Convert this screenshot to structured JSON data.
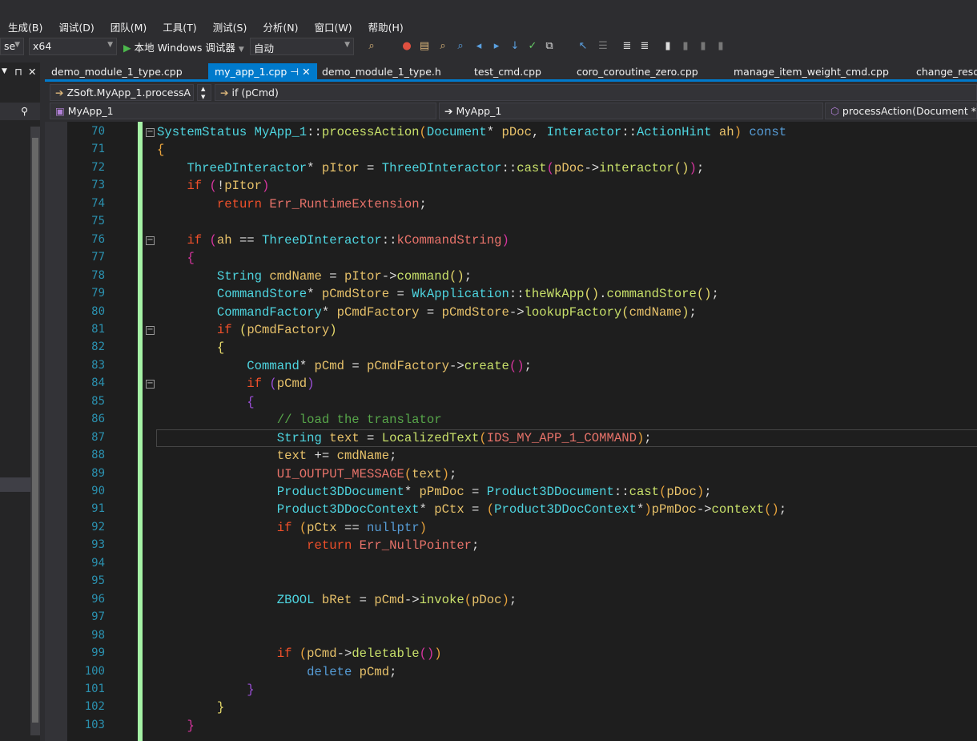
{
  "menu": [
    "生成(B)",
    "调试(D)",
    "团队(M)",
    "工具(T)",
    "测试(S)",
    "分析(N)",
    "窗口(W)",
    "帮助(H)"
  ],
  "toolbar": {
    "config": "se",
    "platform": "x64",
    "run_label": "本地 Windows 调试器",
    "run_icon": "play-icon",
    "mode": "自动"
  },
  "left_panel": {
    "pin": "⊓",
    "close": "✕"
  },
  "tabs": [
    {
      "label": "demo_module_1_type.cpp",
      "active": false
    },
    {
      "label": "my_app_1.cpp",
      "active": true
    },
    {
      "label": "demo_module_1_type.h",
      "active": false
    },
    {
      "label": "test_cmd.cpp",
      "active": false
    },
    {
      "label": "coro_coroutine_zero.cpp",
      "active": false
    },
    {
      "label": "manage_item_weight_cmd.cpp",
      "active": false
    },
    {
      "label": "change_resol",
      "active": false
    }
  ],
  "nav": {
    "scope": "ZSoft.MyApp_1.processA",
    "block": "if (pCmd)",
    "project": "MyApp_1",
    "class": "MyApp_1",
    "member": "processAction(Document * pD"
  },
  "code": {
    "current_line": 87,
    "lines": [
      {
        "n": 70,
        "fold": true,
        "tk": [
          [
            "t",
            "SystemStatus"
          ],
          [
            "o",
            " "
          ],
          [
            "t",
            "MyApp_1"
          ],
          [
            "o",
            "::"
          ],
          [
            "fn",
            "processAction"
          ],
          [
            "b1",
            "("
          ],
          [
            "t",
            "Document"
          ],
          [
            "o",
            "* "
          ],
          [
            "v",
            "pDoc"
          ],
          [
            "o",
            ", "
          ],
          [
            "t",
            "Interactor"
          ],
          [
            "o",
            "::"
          ],
          [
            "t",
            "ActionHint"
          ],
          [
            "o",
            " "
          ],
          [
            "v",
            "ah"
          ],
          [
            "b1",
            ")"
          ],
          [
            "o",
            " "
          ],
          [
            "kb",
            "const"
          ]
        ]
      },
      {
        "n": 71,
        "tk": [
          [
            "b1",
            "{"
          ]
        ]
      },
      {
        "n": 72,
        "tk": [
          [
            "o",
            "    "
          ],
          [
            "t",
            "ThreeDInteractor"
          ],
          [
            "o",
            "* "
          ],
          [
            "v",
            "pItor"
          ],
          [
            "o",
            " = "
          ],
          [
            "t",
            "ThreeDInteractor"
          ],
          [
            "o",
            "::"
          ],
          [
            "fn",
            "cast"
          ],
          [
            "b2",
            "("
          ],
          [
            "v",
            "pDoc"
          ],
          [
            "o",
            "->"
          ],
          [
            "fn",
            "interactor"
          ],
          [
            "b3",
            "()"
          ],
          [
            "b2",
            ")"
          ],
          [
            "o",
            ";"
          ]
        ]
      },
      {
        "n": 73,
        "tk": [
          [
            "o",
            "    "
          ],
          [
            "kw",
            "if"
          ],
          [
            "o",
            " "
          ],
          [
            "b2",
            "("
          ],
          [
            "o",
            "!"
          ],
          [
            "v",
            "pItor"
          ],
          [
            "b2",
            ")"
          ]
        ]
      },
      {
        "n": 74,
        "tk": [
          [
            "o",
            "        "
          ],
          [
            "kw",
            "return"
          ],
          [
            "o",
            " "
          ],
          [
            "c",
            "Err_RuntimeExtension"
          ],
          [
            "o",
            ";"
          ]
        ]
      },
      {
        "n": 75,
        "tk": []
      },
      {
        "n": 76,
        "fold": true,
        "tk": [
          [
            "o",
            "    "
          ],
          [
            "kw",
            "if"
          ],
          [
            "o",
            " "
          ],
          [
            "b2",
            "("
          ],
          [
            "v",
            "ah"
          ],
          [
            "o",
            " == "
          ],
          [
            "t",
            "ThreeDInteractor"
          ],
          [
            "o",
            "::"
          ],
          [
            "c",
            "kCommandString"
          ],
          [
            "b2",
            ")"
          ]
        ]
      },
      {
        "n": 77,
        "tk": [
          [
            "o",
            "    "
          ],
          [
            "b2",
            "{"
          ]
        ]
      },
      {
        "n": 78,
        "tk": [
          [
            "o",
            "        "
          ],
          [
            "t",
            "String"
          ],
          [
            "o",
            " "
          ],
          [
            "v",
            "cmdName"
          ],
          [
            "o",
            " = "
          ],
          [
            "v",
            "pItor"
          ],
          [
            "o",
            "->"
          ],
          [
            "fn",
            "command"
          ],
          [
            "b3",
            "()"
          ],
          [
            "o",
            ";"
          ]
        ]
      },
      {
        "n": 79,
        "tk": [
          [
            "o",
            "        "
          ],
          [
            "t",
            "CommandStore"
          ],
          [
            "o",
            "* "
          ],
          [
            "v",
            "pCmdStore"
          ],
          [
            "o",
            " = "
          ],
          [
            "t",
            "WkApplication"
          ],
          [
            "o",
            "::"
          ],
          [
            "fn",
            "theWkApp"
          ],
          [
            "b3",
            "()"
          ],
          [
            "o",
            "."
          ],
          [
            "fn",
            "commandStore"
          ],
          [
            "b3",
            "()"
          ],
          [
            "o",
            ";"
          ]
        ]
      },
      {
        "n": 80,
        "tk": [
          [
            "o",
            "        "
          ],
          [
            "t",
            "CommandFactory"
          ],
          [
            "o",
            "* "
          ],
          [
            "v",
            "pCmdFactory"
          ],
          [
            "o",
            " = "
          ],
          [
            "v",
            "pCmdStore"
          ],
          [
            "o",
            "->"
          ],
          [
            "fn",
            "lookupFactory"
          ],
          [
            "b3",
            "("
          ],
          [
            "v",
            "cmdName"
          ],
          [
            "b3",
            ")"
          ],
          [
            "o",
            ";"
          ]
        ]
      },
      {
        "n": 81,
        "fold": true,
        "tk": [
          [
            "o",
            "        "
          ],
          [
            "kw",
            "if"
          ],
          [
            "o",
            " "
          ],
          [
            "b3",
            "("
          ],
          [
            "v",
            "pCmdFactory"
          ],
          [
            "b3",
            ")"
          ]
        ]
      },
      {
        "n": 82,
        "tk": [
          [
            "o",
            "        "
          ],
          [
            "b3",
            "{"
          ]
        ]
      },
      {
        "n": 83,
        "tk": [
          [
            "o",
            "            "
          ],
          [
            "t",
            "Command"
          ],
          [
            "o",
            "* "
          ],
          [
            "v",
            "pCmd"
          ],
          [
            "o",
            " = "
          ],
          [
            "v",
            "pCmdFactory"
          ],
          [
            "o",
            "->"
          ],
          [
            "fn",
            "create"
          ],
          [
            "b2",
            "()"
          ],
          [
            "o",
            ";"
          ]
        ]
      },
      {
        "n": 84,
        "fold": true,
        "tk": [
          [
            "o",
            "            "
          ],
          [
            "kw",
            "if"
          ],
          [
            "o",
            " "
          ],
          [
            "b4",
            "("
          ],
          [
            "v",
            "pCmd"
          ],
          [
            "b4",
            ")"
          ]
        ]
      },
      {
        "n": 85,
        "tk": [
          [
            "o",
            "            "
          ],
          [
            "b4",
            "{"
          ]
        ]
      },
      {
        "n": 86,
        "tk": [
          [
            "o",
            "                "
          ],
          [
            "cm",
            "// load the translator"
          ]
        ]
      },
      {
        "n": 87,
        "tk": [
          [
            "o",
            "                "
          ],
          [
            "t",
            "String"
          ],
          [
            "o",
            " "
          ],
          [
            "v",
            "text"
          ],
          [
            "o",
            " = "
          ],
          [
            "fn",
            "LocalizedText"
          ],
          [
            "b1",
            "("
          ],
          [
            "c",
            "IDS_MY_APP_1_COMMAND"
          ],
          [
            "b1",
            ")"
          ],
          [
            "o",
            ";"
          ]
        ]
      },
      {
        "n": 88,
        "tk": [
          [
            "o",
            "                "
          ],
          [
            "v",
            "text"
          ],
          [
            "o",
            " += "
          ],
          [
            "v",
            "cmdName"
          ],
          [
            "o",
            ";"
          ]
        ]
      },
      {
        "n": 89,
        "tk": [
          [
            "o",
            "                "
          ],
          [
            "c",
            "UI_OUTPUT_MESSAGE"
          ],
          [
            "b1",
            "("
          ],
          [
            "v",
            "text"
          ],
          [
            "b1",
            ")"
          ],
          [
            "o",
            ";"
          ]
        ]
      },
      {
        "n": 90,
        "tk": [
          [
            "o",
            "                "
          ],
          [
            "t",
            "Product3DDocument"
          ],
          [
            "o",
            "* "
          ],
          [
            "v",
            "pPmDoc"
          ],
          [
            "o",
            " = "
          ],
          [
            "t",
            "Product3DDocument"
          ],
          [
            "o",
            "::"
          ],
          [
            "fn",
            "cast"
          ],
          [
            "b1",
            "("
          ],
          [
            "v",
            "pDoc"
          ],
          [
            "b1",
            ")"
          ],
          [
            "o",
            ";"
          ]
        ]
      },
      {
        "n": 91,
        "tk": [
          [
            "o",
            "                "
          ],
          [
            "t",
            "Product3DDocContext"
          ],
          [
            "o",
            "* "
          ],
          [
            "v",
            "pCtx"
          ],
          [
            "o",
            " = "
          ],
          [
            "b1",
            "("
          ],
          [
            "t",
            "Product3DDocContext"
          ],
          [
            "o",
            "*"
          ],
          [
            "b1",
            ")"
          ],
          [
            "v",
            "pPmDoc"
          ],
          [
            "o",
            "->"
          ],
          [
            "fn",
            "context"
          ],
          [
            "b1",
            "()"
          ],
          [
            "o",
            ";"
          ]
        ]
      },
      {
        "n": 92,
        "tk": [
          [
            "o",
            "                "
          ],
          [
            "kw",
            "if"
          ],
          [
            "o",
            " "
          ],
          [
            "b1",
            "("
          ],
          [
            "v",
            "pCtx"
          ],
          [
            "o",
            " == "
          ],
          [
            "kb",
            "nullptr"
          ],
          [
            "b1",
            ")"
          ]
        ]
      },
      {
        "n": 93,
        "tk": [
          [
            "o",
            "                    "
          ],
          [
            "kw",
            "return"
          ],
          [
            "o",
            " "
          ],
          [
            "c",
            "Err_NullPointer"
          ],
          [
            "o",
            ";"
          ]
        ]
      },
      {
        "n": 94,
        "tk": []
      },
      {
        "n": 95,
        "tk": []
      },
      {
        "n": 96,
        "tk": [
          [
            "o",
            "                "
          ],
          [
            "t",
            "ZBOOL"
          ],
          [
            "o",
            " "
          ],
          [
            "v",
            "bRet"
          ],
          [
            "o",
            " = "
          ],
          [
            "v",
            "pCmd"
          ],
          [
            "o",
            "->"
          ],
          [
            "fn",
            "invoke"
          ],
          [
            "b1",
            "("
          ],
          [
            "v",
            "pDoc"
          ],
          [
            "b1",
            ")"
          ],
          [
            "o",
            ";"
          ]
        ]
      },
      {
        "n": 97,
        "tk": []
      },
      {
        "n": 98,
        "tk": []
      },
      {
        "n": 99,
        "tk": [
          [
            "o",
            "                "
          ],
          [
            "kw",
            "if"
          ],
          [
            "o",
            " "
          ],
          [
            "b1",
            "("
          ],
          [
            "v",
            "pCmd"
          ],
          [
            "o",
            "->"
          ],
          [
            "fn",
            "deletable"
          ],
          [
            "b2",
            "()"
          ],
          [
            "b1",
            ")"
          ]
        ]
      },
      {
        "n": 100,
        "tk": [
          [
            "o",
            "                    "
          ],
          [
            "kb",
            "delete"
          ],
          [
            "o",
            " "
          ],
          [
            "v",
            "pCmd"
          ],
          [
            "o",
            ";"
          ]
        ]
      },
      {
        "n": 101,
        "tk": [
          [
            "o",
            "            "
          ],
          [
            "b4",
            "}"
          ]
        ]
      },
      {
        "n": 102,
        "tk": [
          [
            "o",
            "        "
          ],
          [
            "b3",
            "}"
          ]
        ]
      },
      {
        "n": 103,
        "tk": [
          [
            "o",
            "    "
          ],
          [
            "b2",
            "}"
          ]
        ]
      }
    ]
  },
  "colors": {
    "accent": "#007acc",
    "editor_bg": "#1e1e1e",
    "line_number": "#2b91af",
    "change_bar": "#a6f2a6"
  }
}
